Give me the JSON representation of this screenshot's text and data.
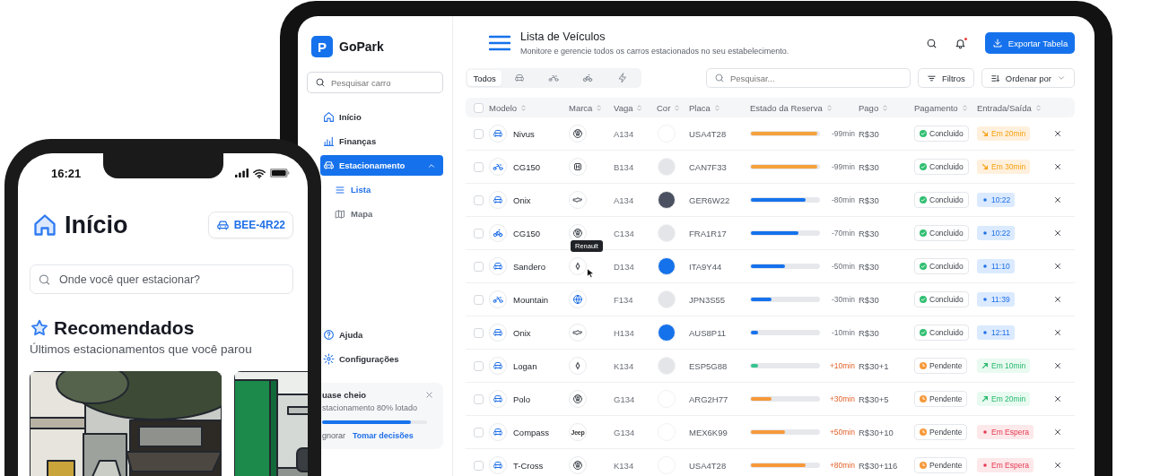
{
  "phone": {
    "time": "16:21",
    "title": "Início",
    "plate": "BEE-4R22",
    "search": {
      "placeholder": "Onde você quer estacionar?"
    },
    "section_title": "Recomendados",
    "section_subtitle": "Últimos estacionamentos que você parou",
    "places": [
      {
        "kind": "street"
      },
      {
        "kind": "garage"
      }
    ]
  },
  "sidebar": {
    "logo": "P",
    "brand": "GoPark",
    "search": {
      "placeholder": "Pesquisar carro"
    },
    "items": [
      {
        "label": "Início",
        "selected": false
      },
      {
        "label": "Finanças",
        "selected": false
      },
      {
        "label": "Estacionamento",
        "selected": true,
        "expanded": true,
        "children": [
          {
            "label": "Lista",
            "selected": true
          },
          {
            "label": "Mapa",
            "selected": false
          }
        ]
      }
    ],
    "footer_items": [
      {
        "label": "Ajuda"
      },
      {
        "label": "Configurações"
      }
    ],
    "alert": {
      "title": "uase cheio",
      "message": "stacionamento 80% lotado",
      "level": 0.85,
      "dismiss": "gnorar",
      "action": "Tomar decisões"
    }
  },
  "header": {
    "title": "Lista de Veículos",
    "subtitle": "Monitore e gerencie todos os carros estacionados no seu estabelecimento.",
    "notification": true,
    "export_button": "Exportar Tabela"
  },
  "toolbar": {
    "tabs": [
      {
        "kind": "text",
        "label": "Todos",
        "selected": true
      },
      {
        "kind": "car",
        "selected": false
      },
      {
        "kind": "moto",
        "selected": false
      },
      {
        "kind": "bike",
        "selected": false
      },
      {
        "kind": "electric",
        "selected": false
      }
    ],
    "search": {
      "placeholder": "Pesquisar..."
    },
    "filter": "Filtros",
    "sort": "Ordenar por"
  },
  "table": {
    "all_checked": false,
    "columns": [
      "Modelo",
      "Marca",
      "Vaga",
      "Cor",
      "Placa",
      "Estado da Reserva",
      "Pago",
      "Pagamento",
      "Entrada/Saída"
    ],
    "rows": [
      {
        "checked": false,
        "vehicle": {
          "kind": "car"
        },
        "model": "Nivus",
        "brand": {
          "kind": "vw"
        },
        "slot": "A134",
        "color": "#ffffff",
        "plate": "USA4T28",
        "reservation": {
          "kind": "warning",
          "level": 0.98,
          "reading": "-99min"
        },
        "paid": "R$30",
        "payment": {
          "kind": "done",
          "label": "Concluido"
        },
        "entry": {
          "kind": "arriving",
          "label": "Em 20min"
        }
      },
      {
        "checked": false,
        "vehicle": {
          "kind": "moto"
        },
        "model": "CG150",
        "brand": {
          "kind": "honda"
        },
        "slot": "B134",
        "color": "#e4e5e8",
        "plate": "CAN7F33",
        "reservation": {
          "kind": "warning",
          "level": 0.98,
          "reading": "-99min"
        },
        "paid": "R$30",
        "payment": {
          "kind": "done",
          "label": "Concluido"
        },
        "entry": {
          "kind": "arriving",
          "label": "Em 30min"
        }
      },
      {
        "checked": false,
        "vehicle": {
          "kind": "car"
        },
        "model": "Onix",
        "brand": {
          "kind": "chevrolet"
        },
        "slot": "A134",
        "color": "#4b5160",
        "plate": "GER6W22",
        "reservation": {
          "kind": "normal",
          "level": 0.8,
          "reading": "-80min"
        },
        "paid": "R$30",
        "payment": {
          "kind": "done",
          "label": "Concluido"
        },
        "entry": {
          "kind": "time",
          "label": "10:22"
        }
      },
      {
        "checked": false,
        "vehicle": {
          "kind": "bike"
        },
        "model": "CG150",
        "brand": {
          "kind": "vw"
        },
        "slot": "C134",
        "color": "#e4e5e8",
        "plate": "FRA1R17",
        "reservation": {
          "kind": "normal",
          "level": 0.7,
          "reading": "-70min"
        },
        "paid": "R$30",
        "payment": {
          "kind": "done",
          "label": "Concluido"
        },
        "entry": {
          "kind": "time",
          "label": "10:22"
        }
      },
      {
        "checked": false,
        "vehicle": {
          "kind": "car"
        },
        "model": "Sandero",
        "brand": {
          "kind": "renault",
          "tooltip": "Renault"
        },
        "slot": "D134",
        "color": "#1572ea",
        "plate": "ITA9Y44",
        "reservation": {
          "kind": "normal",
          "level": 0.5,
          "reading": "-50min"
        },
        "paid": "R$30",
        "payment": {
          "kind": "done",
          "label": "Concluido"
        },
        "entry": {
          "kind": "time",
          "label": "11:10"
        }
      },
      {
        "checked": false,
        "vehicle": {
          "kind": "moto"
        },
        "model": "Mountain",
        "brand": {
          "kind": "globe"
        },
        "slot": "F134",
        "color": "#e4e5e8",
        "plate": "JPN3S55",
        "reservation": {
          "kind": "normal",
          "level": 0.3,
          "reading": "-30min"
        },
        "paid": "R$30",
        "payment": {
          "kind": "done",
          "label": "Concluido"
        },
        "entry": {
          "kind": "time",
          "label": "11:39"
        }
      },
      {
        "checked": false,
        "vehicle": {
          "kind": "car"
        },
        "model": "Onix",
        "brand": {
          "kind": "chevrolet"
        },
        "slot": "H134",
        "color": "#1572ea",
        "plate": "AUS8P11",
        "reservation": {
          "kind": "normal",
          "level": 0.1,
          "reading": "-10min"
        },
        "paid": "R$30",
        "payment": {
          "kind": "done",
          "label": "Concluido"
        },
        "entry": {
          "kind": "time",
          "label": "12:11"
        }
      },
      {
        "checked": false,
        "vehicle": {
          "kind": "car"
        },
        "model": "Logan",
        "brand": {
          "kind": "renault"
        },
        "slot": "K134",
        "color": "#e4e5e8",
        "plate": "ESP5G88",
        "reservation": {
          "kind": "fresh",
          "level": 0.1,
          "reading": "+10min"
        },
        "paid": "R$30+1",
        "payment": {
          "kind": "pending",
          "label": "Pendente"
        },
        "entry": {
          "kind": "leaving",
          "label": "Em 10min"
        }
      },
      {
        "checked": false,
        "vehicle": {
          "kind": "car"
        },
        "model": "Polo",
        "brand": {
          "kind": "vw"
        },
        "slot": "G134",
        "color": "#ffffff",
        "plate": "ARG2H77",
        "reservation": {
          "kind": "overtime",
          "level": 0.3,
          "reading": "+30min"
        },
        "paid": "R$30+5",
        "payment": {
          "kind": "pending",
          "label": "Pendente"
        },
        "entry": {
          "kind": "leaving",
          "label": "Em 20min"
        }
      },
      {
        "checked": false,
        "vehicle": {
          "kind": "car"
        },
        "model": "Compass",
        "brand": {
          "kind": "text",
          "text": "Jeep"
        },
        "slot": "G134",
        "color": "#ffffff",
        "plate": "MEX6K99",
        "reservation": {
          "kind": "overtime",
          "level": 0.5,
          "reading": "+50min"
        },
        "paid": "R$30+10",
        "payment": {
          "kind": "pending",
          "label": "Pendente"
        },
        "entry": {
          "kind": "waiting",
          "label": "Em Espera"
        }
      },
      {
        "checked": false,
        "vehicle": {
          "kind": "car"
        },
        "model": "T-Cross",
        "brand": {
          "kind": "vw"
        },
        "slot": "K134",
        "color": "#ffffff",
        "plate": "USA4T28",
        "reservation": {
          "kind": "overtime",
          "level": 0.8,
          "reading": "+80min"
        },
        "paid": "R$30+116",
        "payment": {
          "kind": "pending",
          "label": "Pendente"
        },
        "entry": {
          "kind": "waiting",
          "label": "Em Espera"
        }
      }
    ]
  }
}
